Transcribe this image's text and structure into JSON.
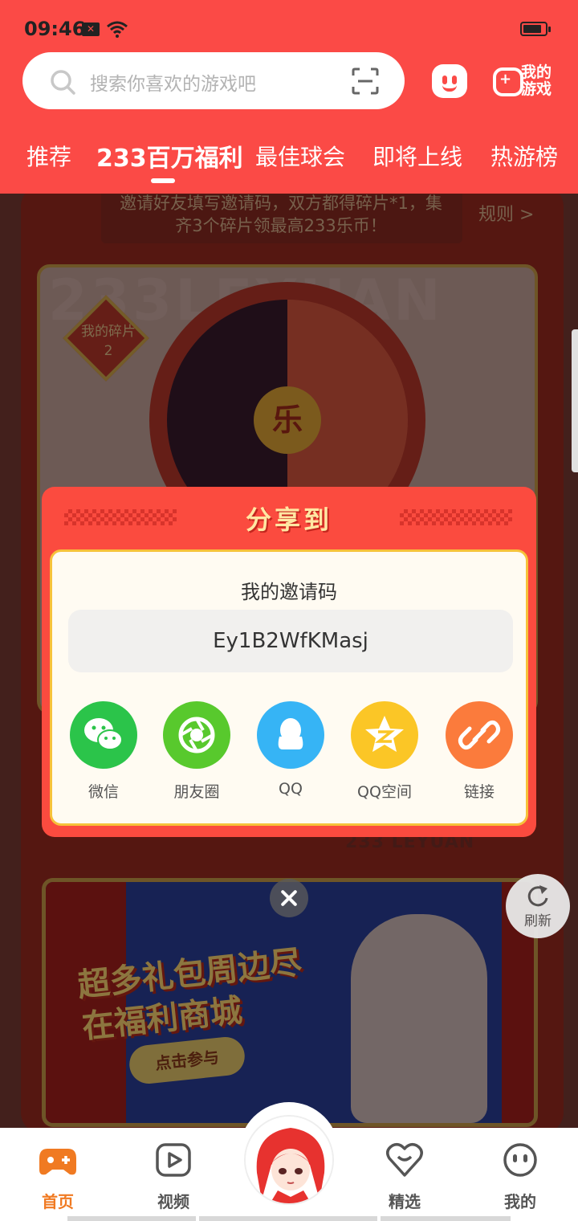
{
  "status_bar": {
    "time": "09:46",
    "notification_badge": "✕"
  },
  "search": {
    "placeholder": "搜索你喜欢的游戏吧"
  },
  "header": {
    "my_games_label": "我的游戏"
  },
  "tabs": [
    {
      "label": "推荐",
      "active": false
    },
    {
      "label": "233百万福利",
      "active": true
    },
    {
      "label": "最佳球会",
      "active": false
    },
    {
      "label": "即将上线",
      "active": false
    },
    {
      "label": "热游榜",
      "active": false
    }
  ],
  "background": {
    "rules_text": "邀请好友填写邀请码，双方都得碎片*1，集齐3个碎片领最高233乐币！",
    "rules_link": "规则 >",
    "watermark": "233LEYUAN",
    "my_pieces_label": "我的碎片",
    "my_pieces_count": "2",
    "center_char": "乐",
    "section_title": "233 LEYUAN",
    "banner_title": "超多礼包周边尽在福利商城",
    "banner_button": "点击参与"
  },
  "share_dialog": {
    "title": "分享到",
    "invite_label": "我的邀请码",
    "invite_code": "Ey1B2WfKMasj",
    "targets": [
      {
        "label": "微信",
        "icon": "wechat-icon",
        "color": "#2bc44a"
      },
      {
        "label": "朋友圈",
        "icon": "moments-icon",
        "color": "#58c92d"
      },
      {
        "label": "QQ",
        "icon": "qq-icon",
        "color": "#36b4f5"
      },
      {
        "label": "QQ空间",
        "icon": "qzone-icon",
        "color": "#fbc626"
      },
      {
        "label": "链接",
        "icon": "link-icon",
        "color": "#fb7b3c"
      }
    ]
  },
  "refresh": {
    "label": "刷新"
  },
  "bottom_nav": [
    {
      "label": "首页",
      "icon": "gamepad-icon",
      "active": true
    },
    {
      "label": "视频",
      "icon": "video-icon",
      "active": false
    },
    {
      "label": "精选",
      "icon": "heart-icon",
      "active": false
    },
    {
      "label": "我的",
      "icon": "face-icon",
      "active": false
    }
  ],
  "colors": {
    "brand_red": "#fb4a46",
    "nav_active": "#f07a22",
    "dialog_gold": "#f6c23a"
  }
}
